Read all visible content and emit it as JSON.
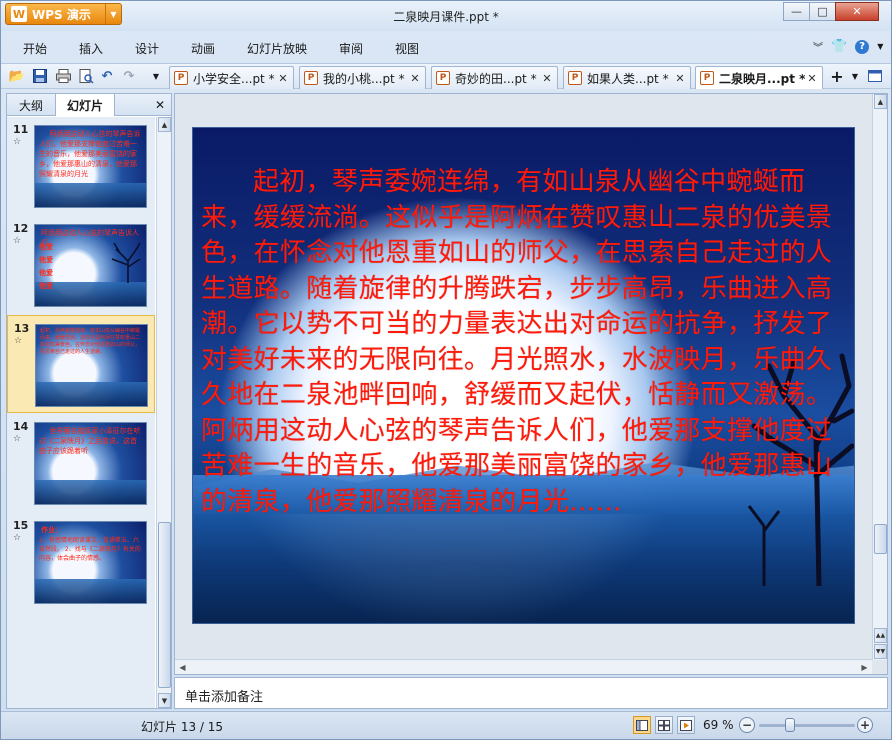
{
  "app": {
    "name": "WPS 演示",
    "logo_glyph": "W",
    "window_title": "二泉映月课件.ppt *"
  },
  "window_controls": {
    "minimize": "—",
    "maximize": "□",
    "close": "✕"
  },
  "menu": {
    "items": [
      "开始",
      "插入",
      "设计",
      "动画",
      "幻灯片放映",
      "审阅",
      "视图"
    ]
  },
  "document_tabs": [
    {
      "label": "小学安全...pt *",
      "close": "✕",
      "active": false
    },
    {
      "label": "我的小桃...pt *",
      "close": "✕",
      "active": false
    },
    {
      "label": "奇妙的田...pt *",
      "close": "✕",
      "active": false
    },
    {
      "label": "如果人类...pt *",
      "close": "✕",
      "active": false
    },
    {
      "label": "二泉映月...pt *",
      "close": "✕",
      "active": true
    }
  ],
  "left_panel": {
    "tabs": [
      "大纲",
      "幻灯片"
    ],
    "active_tab": "幻灯片",
    "close": "✕",
    "thumbnails": [
      {
        "number": "11",
        "selected": false,
        "text": "阿炳用这动人心弦的琴声告诉人们，他爱那支撑他度过苦难一生的音乐，他爱那美丽富饶的家乡，他爱那惠山的清泉，他爱那照耀清泉的月光"
      },
      {
        "number": "12",
        "selected": false,
        "title": "阿炳用这动人心弦的琴声告诉人们，",
        "list": [
          "他爱",
          "他爱",
          "他爱",
          "他爱"
        ]
      },
      {
        "number": "13",
        "selected": true,
        "text": "起初，琴声委婉连绵，有如山泉从幽谷中蜿蜒而来，缓缓流淌。这似乎是阿炳在赞叹惠山二泉的优美景色，在怀念对他恩重如山的师父，在思索自己走过的人生道路。"
      },
      {
        "number": "14",
        "selected": false,
        "text": "世界著名指挥家小泽征尔在听过《二泉映月》之后曾说，这首曲子应该跪着听"
      },
      {
        "number": "15",
        "selected": false,
        "title": "作业：",
        "text": "1、有感情地朗读课文，背诵第五、六自然段。 2、找与《二泉映月》有关的内容，体会曲子的情感。"
      }
    ]
  },
  "slide": {
    "body": "起初，琴声委婉连绵，有如山泉从幽谷中蜿蜒而来，缓缓流淌。这似乎是阿炳在赞叹惠山二泉的优美景色，在怀念对他恩重如山的师父，在思索自己走过的人生道路。随着旋律的升腾跌宕，步步高昂，乐曲进入高潮。它以势不可当的力量表达出对命运的抗争，抒发了对美好未来的无限向往。月光照水，水波映月，乐曲久久地在二泉池畔回响，舒缓而又起伏，恬静而又激荡。阿炳用这动人心弦的琴声告诉人们，他爱那支撑他度过苦难一生的音乐，他爱那美丽富饶的家乡，他爱那惠山的清泉，他爱那照耀清泉的月光……",
    "text_color": "#ff1a0a"
  },
  "notes": {
    "placeholder": "单击添加备注"
  },
  "status": {
    "slide_indicator": "幻灯片 13 / 15",
    "zoom": "69 %",
    "zoom_level": 0.69
  }
}
